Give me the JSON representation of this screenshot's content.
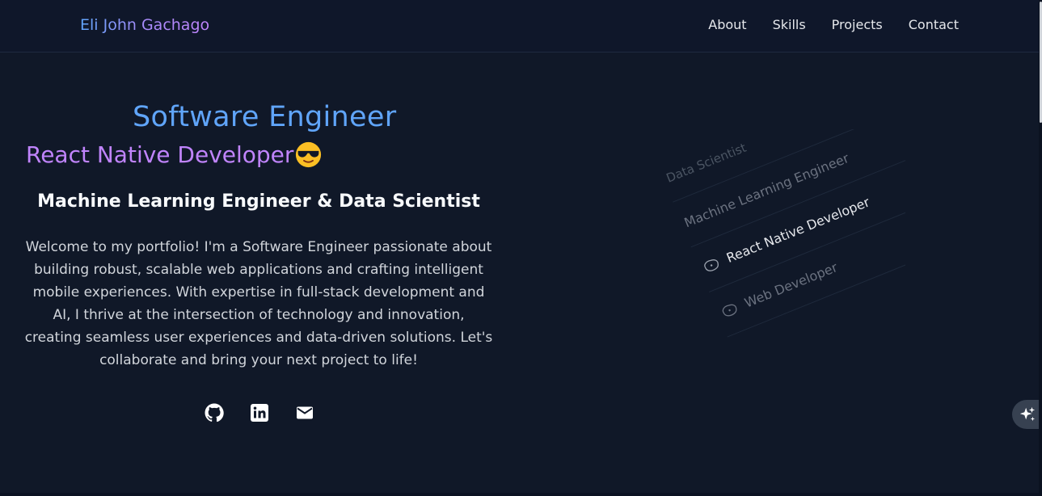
{
  "brand": {
    "name": "Eli John Gachago"
  },
  "nav": {
    "items": [
      {
        "label": "About"
      },
      {
        "label": "Skills"
      },
      {
        "label": "Projects"
      },
      {
        "label": "Contact"
      }
    ]
  },
  "hero": {
    "title_primary": "Software Engineer",
    "title_secondary": "React Native Developer",
    "title_emoji": "sunglasses-face-icon",
    "subtitle": "Machine Learning Engineer & Data Scientist",
    "intro": "Welcome to my portfolio! I'm a Software Engineer passionate about building robust, scalable web applications and crafting intelligent mobile experiences. With expertise in full-stack development and AI, I thrive at the intersection of technology and innovation, creating seamless user experiences and data-driven solutions. Let's collaborate and bring your next project to life!",
    "socials": [
      {
        "icon": "github-icon"
      },
      {
        "icon": "linkedin-icon"
      },
      {
        "icon": "email-icon"
      }
    ]
  },
  "roles": {
    "items": [
      {
        "label": "Data Scientist"
      },
      {
        "label": "Machine Learning Engineer"
      },
      {
        "label": "React Native Developer"
      },
      {
        "label": "Web Developer"
      }
    ]
  },
  "assistant": {
    "icon": "sparkles-icon"
  },
  "colors": {
    "background": "#101828",
    "accent_blue": "#60a5fa",
    "accent_purple": "#c084fc"
  }
}
